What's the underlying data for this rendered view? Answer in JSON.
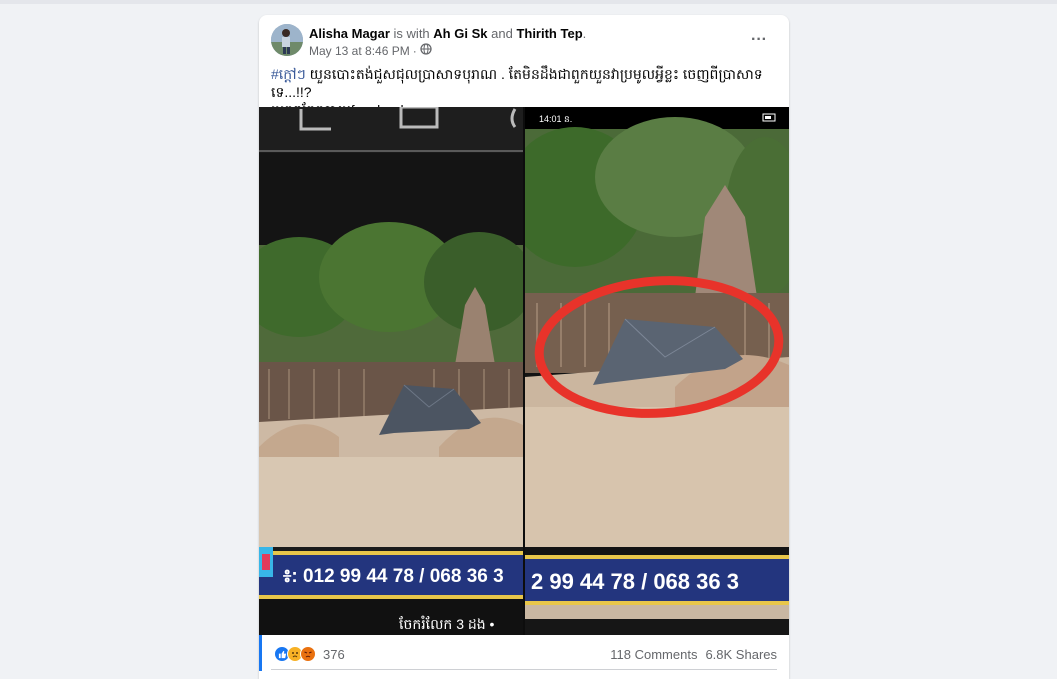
{
  "post": {
    "author": "Alisha Magar",
    "with_text": "is with",
    "tagged_1": "Ah Gi Sk",
    "and_text": "and",
    "tagged_2": "Thirith Tep",
    "period": ".",
    "timestamp": "May 13 at 8:46 PM",
    "separator": "·",
    "privacy_icon": "globe-icon",
    "more_icon": "more-options-icon",
    "more_label": "···",
    "hashtag": "#ក្តៅៗ",
    "caption_line1": " យួនបោះតង់ជួសជុលប្រាសាទបុរាណ . តែមិនដឹងជាពួកយួនវាប្រមូលអ្វីខ្លះ ចេញពីប្រាសាទទេ...!!?",
    "caption_line2": "ប្រភពចែកចាយfacebook"
  },
  "media": {
    "left_phone": "៖: 012 99 44 78 / 068 36 3",
    "right_phone": "2 99 44 78 / 068 36 3",
    "right_status_time": "14:01 ន.",
    "left_bottom_text": "ចែករំលែក 3 ដង •"
  },
  "stats": {
    "reaction_icons": [
      "like-icon",
      "sad-icon",
      "angry-icon"
    ],
    "reaction_count": "376",
    "comments": "118 Comments",
    "shares": "6.8K Shares"
  },
  "colors": {
    "link": "#385898",
    "accent": "#1877f2",
    "muted": "#65676b",
    "circle": "#e8332a"
  }
}
